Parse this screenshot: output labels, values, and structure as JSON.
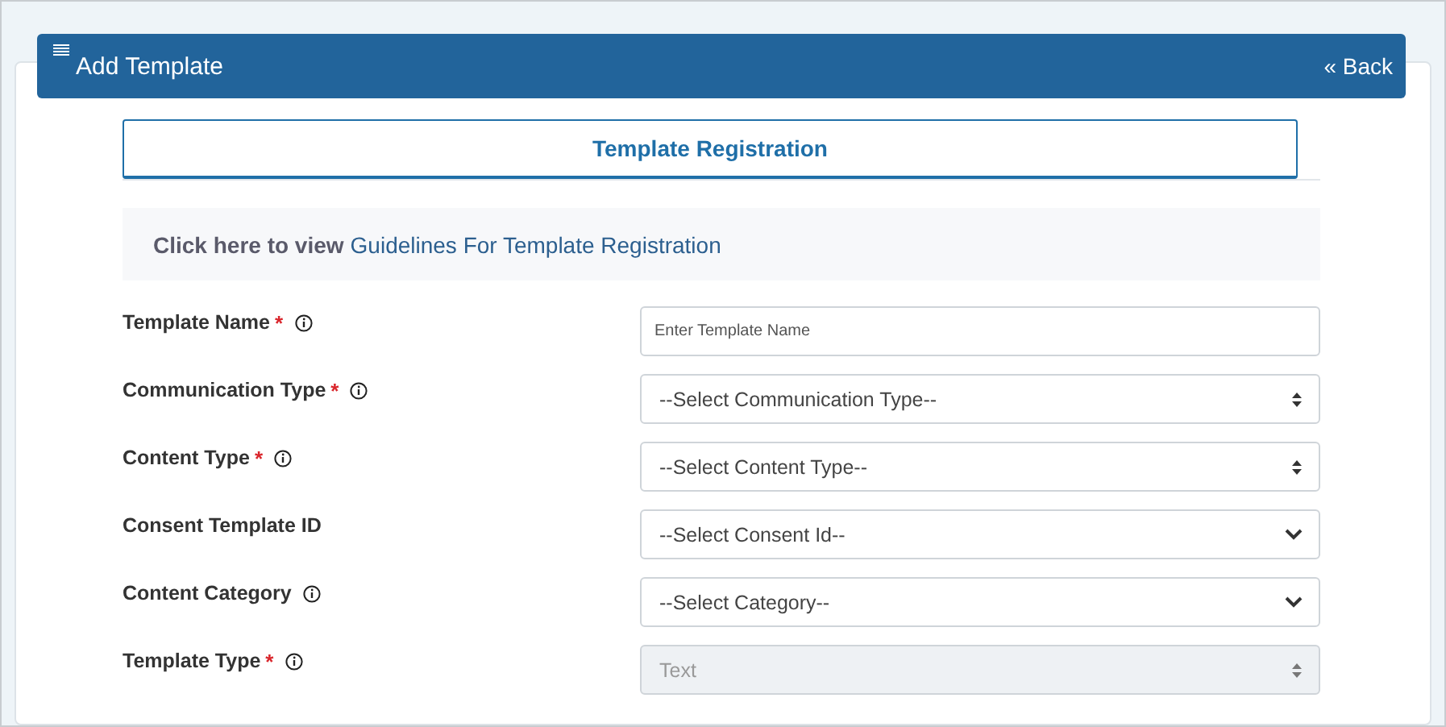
{
  "header": {
    "title": "Add Template",
    "back": "« Back"
  },
  "tabs": [
    {
      "label": "Template Registration",
      "selected": true
    }
  ],
  "guidelines": {
    "prefix": "Click here to view",
    "link": "Guidelines For Template Registration"
  },
  "fields": [
    {
      "label": "Template Name",
      "required": true,
      "info": true,
      "kind": "input",
      "placeholder": "Enter Template Name",
      "disabled": false
    },
    {
      "label": "Communication Type",
      "required": true,
      "info": true,
      "kind": "select-updown",
      "value": "--Select Communication Type--",
      "disabled": false
    },
    {
      "label": "Content Type",
      "required": true,
      "info": true,
      "kind": "select-updown",
      "value": "--Select Content Type--",
      "disabled": false
    },
    {
      "label": "Consent Template ID",
      "required": false,
      "info": false,
      "kind": "select-chevron",
      "value": "--Select Consent Id--",
      "disabled": false
    },
    {
      "label": "Content Category",
      "required": false,
      "info": true,
      "kind": "select-chevron",
      "value": "--Select Category--",
      "disabled": false
    },
    {
      "label": "Template Type",
      "required": true,
      "info": true,
      "kind": "select-updown",
      "value": "Text",
      "disabled": true
    }
  ],
  "required_mark": "*"
}
